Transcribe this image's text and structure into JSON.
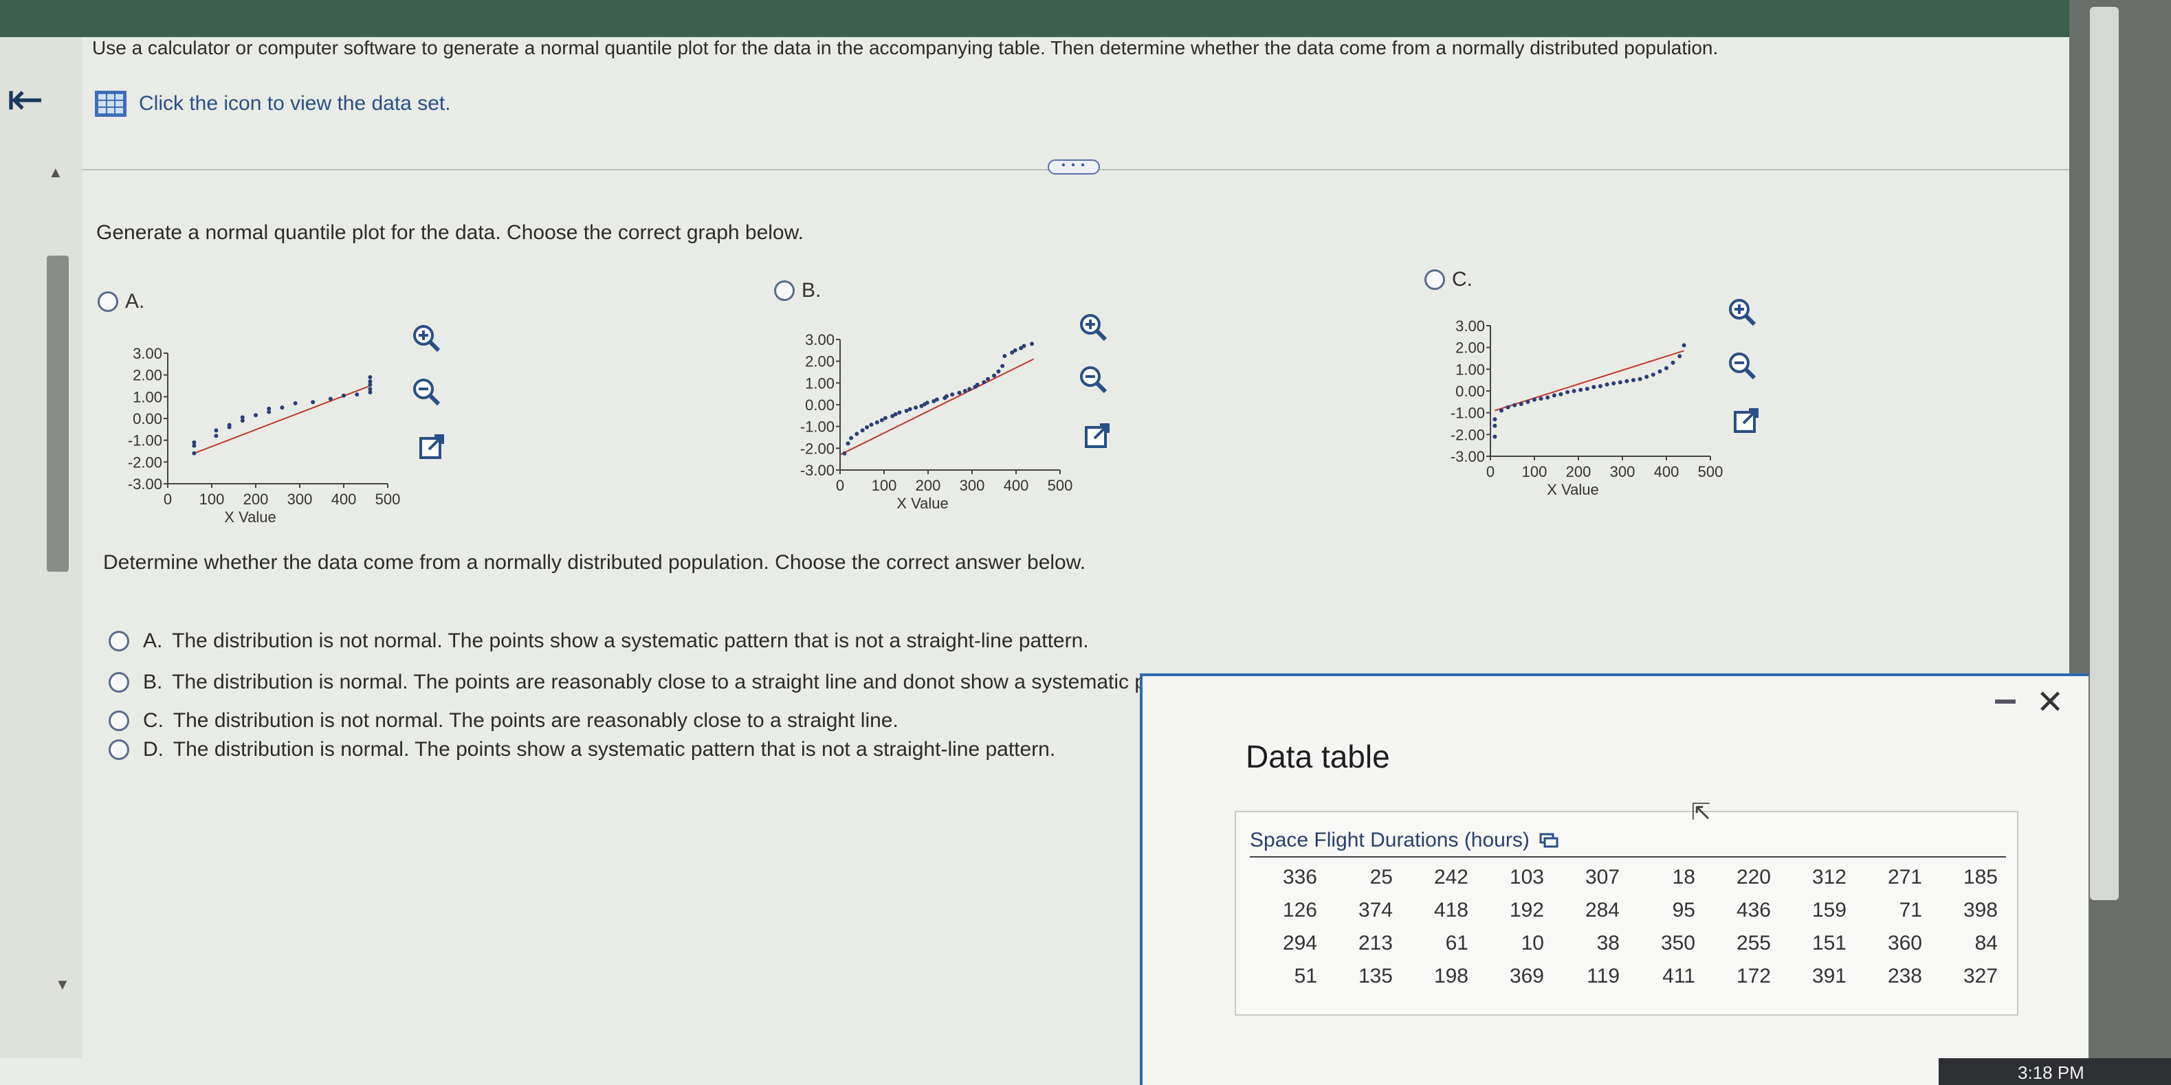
{
  "header": {
    "instruction": "Use a calculator or computer software to generate a normal quantile plot for the data in the accompanying table. Then determine whether the data come from a normally distributed population.",
    "data_link_label": "Click the icon to view the data set.",
    "more_label": "• • •"
  },
  "question1": {
    "prompt": "Generate a normal quantile plot for the data. Choose the correct graph below.",
    "options": [
      {
        "label": "A."
      },
      {
        "label": "B."
      },
      {
        "label": "C."
      }
    ]
  },
  "question2": {
    "prompt": "Determine whether the data come from a normally distributed population. Choose the correct answer below.",
    "answers": [
      {
        "letter": "A.",
        "text": "The distribution is not normal. The points show a systematic pattern that is not a  straight-line pattern."
      },
      {
        "letter": "B.",
        "text": "The distribution is normal. The points are reasonably close to a straight line and donot show a systematic pattern that is not a straight-line pattern."
      },
      {
        "letter": "C.",
        "text": "The distribution is not normal. The points are reasonably close to a straight line."
      },
      {
        "letter": "D.",
        "text": "The distribution is normal. The points show a systematic pattern that is not a straight-line pattern."
      }
    ]
  },
  "data_popup": {
    "title": "Data table",
    "caption": "Space Flight Durations (hours)",
    "rows": [
      [
        "336",
        "25",
        "242",
        "103",
        "307",
        "18",
        "220",
        "312",
        "271",
        "185"
      ],
      [
        "126",
        "374",
        "418",
        "192",
        "284",
        "95",
        "436",
        "159",
        "71",
        "398"
      ],
      [
        "294",
        "213",
        "61",
        "10",
        "38",
        "350",
        "255",
        "151",
        "360",
        "84"
      ],
      [
        "51",
        "135",
        "198",
        "369",
        "119",
        "411",
        "172",
        "391",
        "238",
        "327"
      ]
    ]
  },
  "system": {
    "clock": "3:18 PM"
  },
  "chart_data": [
    {
      "type": "scatter",
      "title": "",
      "xlabel": "X Value",
      "ylabel": "",
      "xlim": [
        0,
        500
      ],
      "ylim": [
        -3,
        3
      ],
      "x_ticks": [
        "0",
        "100",
        "200",
        "300",
        "400",
        "500"
      ],
      "y_ticks": [
        "3.00",
        "2.00",
        "1.00",
        "0.00",
        "-1.00",
        "-2.00",
        "-3.00"
      ],
      "fit_line": {
        "x": [
          60,
          460
        ],
        "y": [
          -1.6,
          1.5
        ]
      },
      "colors": {
        "points": "#2c3e78",
        "line": "#c0392b"
      },
      "points": {
        "x": [
          60,
          60,
          60,
          110,
          110,
          140,
          140,
          170,
          170,
          200,
          230,
          230,
          260,
          290,
          330,
          370,
          400,
          430,
          460,
          460,
          460,
          460,
          460
        ],
        "y": [
          -1.6,
          -1.25,
          -1.1,
          -0.8,
          -0.55,
          -0.4,
          -0.3,
          -0.1,
          0.05,
          0.15,
          0.3,
          0.45,
          0.5,
          0.7,
          0.75,
          0.9,
          1.05,
          1.1,
          1.2,
          1.35,
          1.55,
          1.7,
          1.9
        ]
      }
    },
    {
      "type": "scatter",
      "title": "",
      "xlabel": "X Value",
      "ylabel": "",
      "xlim": [
        0,
        500
      ],
      "ylim": [
        -3,
        3
      ],
      "x_ticks": [
        "0",
        "100",
        "200",
        "300",
        "400",
        "500"
      ],
      "y_ticks": [
        "3.00",
        "2.00",
        "1.00",
        "0.00",
        "-1.00",
        "-2.00",
        "-3.00"
      ],
      "fit_line": {
        "x": [
          0,
          440
        ],
        "y": [
          -2.3,
          2.1
        ]
      },
      "colors": {
        "points": "#2c3e78",
        "line": "#c0392b"
      },
      "points": {
        "x": [
          10,
          18,
          25,
          38,
          51,
          61,
          71,
          84,
          95,
          103,
          119,
          126,
          135,
          151,
          159,
          172,
          185,
          192,
          198,
          213,
          220,
          238,
          242,
          255,
          271,
          284,
          294,
          307,
          312,
          327,
          336,
          350,
          360,
          369,
          374,
          391,
          398,
          411,
          418,
          436
        ],
        "y": [
          -2.24,
          -1.78,
          -1.53,
          -1.34,
          -1.18,
          -1.04,
          -0.92,
          -0.81,
          -0.71,
          -0.61,
          -0.52,
          -0.44,
          -0.36,
          -0.28,
          -0.2,
          -0.13,
          -0.06,
          0.02,
          0.09,
          0.16,
          0.24,
          0.31,
          0.39,
          0.47,
          0.55,
          0.63,
          0.72,
          0.82,
          0.92,
          1.04,
          1.18,
          1.34,
          1.53,
          1.78,
          2.24,
          2.4,
          2.5,
          2.6,
          2.7,
          2.8
        ]
      }
    },
    {
      "type": "scatter",
      "title": "",
      "xlabel": "X Value",
      "ylabel": "",
      "xlim": [
        0,
        500
      ],
      "ylim": [
        -3,
        3
      ],
      "x_ticks": [
        "0",
        "100",
        "200",
        "300",
        "400",
        "500"
      ],
      "y_ticks": [
        "3.00",
        "2.00",
        "1.00",
        "0.00",
        "-1.00",
        "-2.00",
        "-3.00"
      ],
      "fit_line": {
        "x": [
          10,
          440
        ],
        "y": [
          -0.9,
          1.85
        ]
      },
      "colors": {
        "points": "#2c3e78",
        "line": "#c0392b"
      },
      "points": {
        "x": [
          10,
          10,
          10,
          25,
          40,
          55,
          70,
          85,
          100,
          115,
          130,
          145,
          160,
          175,
          190,
          205,
          220,
          235,
          250,
          265,
          280,
          295,
          310,
          325,
          340,
          355,
          370,
          385,
          400,
          415,
          430,
          440
        ],
        "y": [
          -2.1,
          -1.6,
          -1.3,
          -0.9,
          -0.75,
          -0.65,
          -0.6,
          -0.5,
          -0.4,
          -0.35,
          -0.3,
          -0.2,
          -0.15,
          -0.05,
          0.0,
          0.05,
          0.1,
          0.18,
          0.22,
          0.3,
          0.35,
          0.4,
          0.45,
          0.5,
          0.55,
          0.65,
          0.75,
          0.9,
          1.05,
          1.3,
          1.6,
          2.1
        ]
      }
    }
  ]
}
